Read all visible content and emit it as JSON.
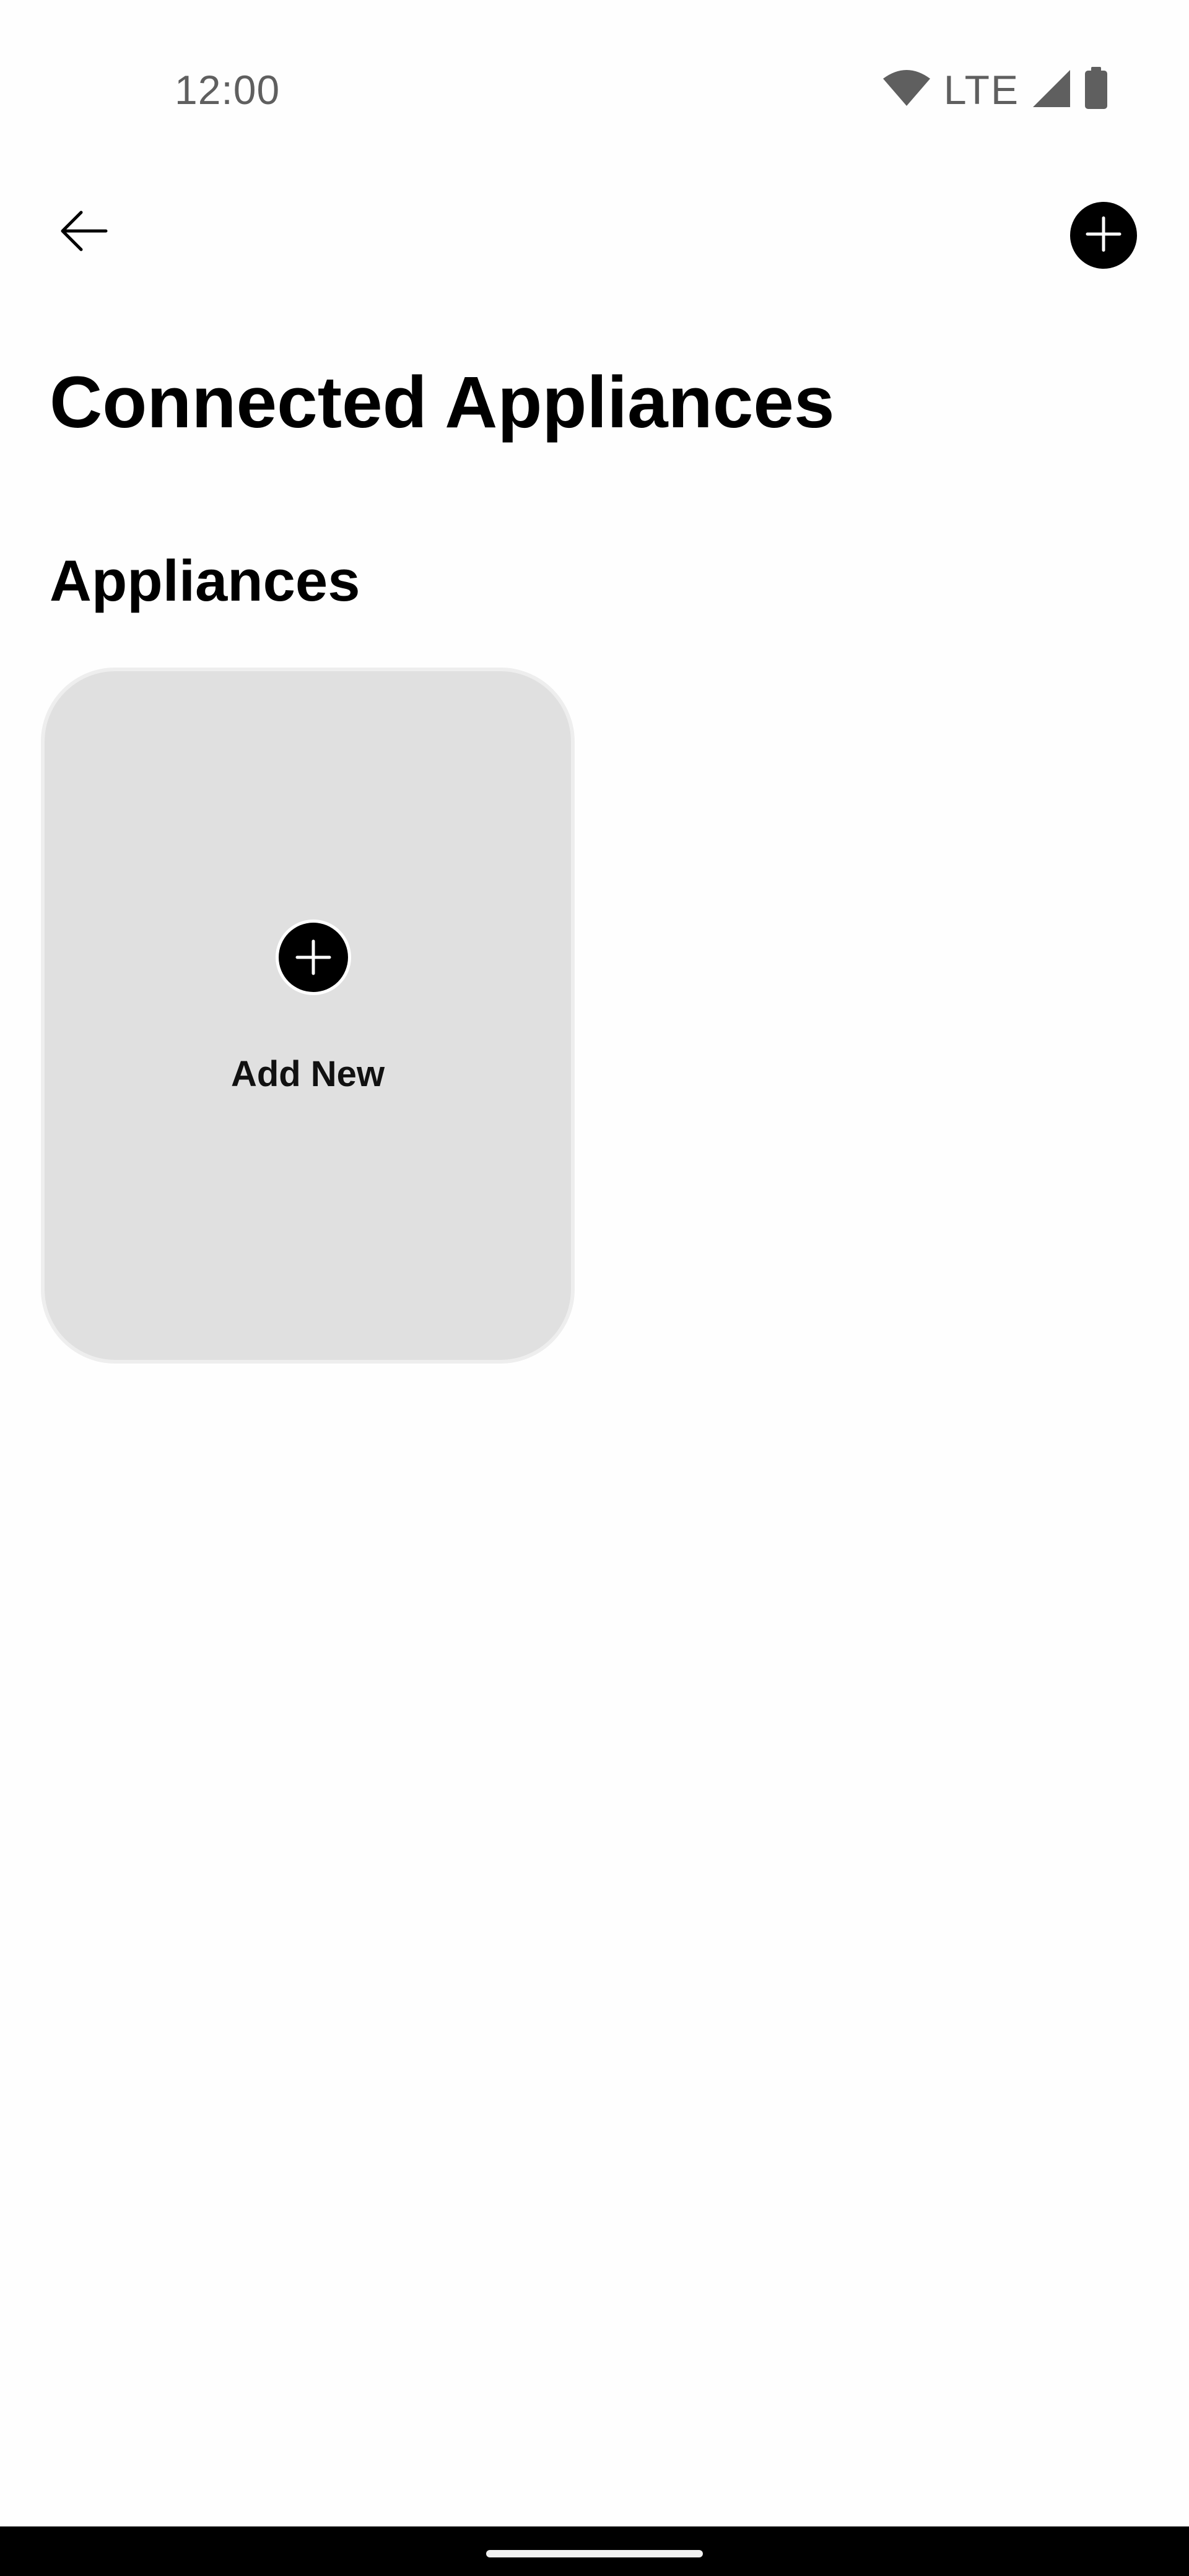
{
  "status_bar": {
    "time": "12:00",
    "network": "LTE",
    "icons": [
      "wifi-icon",
      "cellular-signal-icon",
      "battery-icon"
    ]
  },
  "app_bar": {
    "back_icon": "arrow-left-icon",
    "add_icon": "plus-icon"
  },
  "page": {
    "title": "Connected Appliances",
    "section_title": "Appliances"
  },
  "add_card": {
    "icon": "plus-icon",
    "label": "Add New"
  },
  "colors": {
    "card_background": "#e0e0e0",
    "accent": "#000000",
    "status_text": "#5f5f5f"
  }
}
